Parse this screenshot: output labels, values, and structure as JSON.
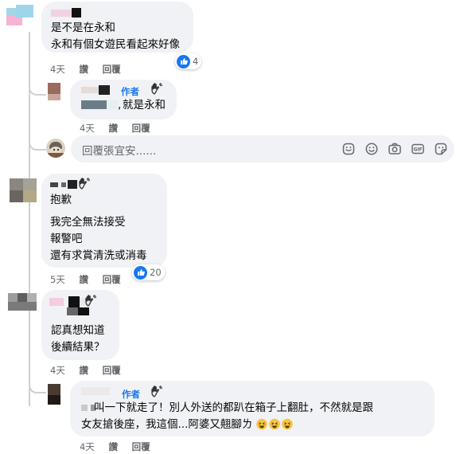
{
  "comments": [
    {
      "lines": [
        "是不是在永和",
        "永和有個女遊民看起來好像"
      ],
      "reaction_count": "4",
      "actions": [
        "4天",
        "讚",
        "回覆"
      ]
    },
    {
      "author_badge": "作者",
      "lines_prefix": ",",
      "text": "就是永和",
      "actions": [
        "4天",
        "讚",
        "回覆"
      ]
    },
    {
      "lines": [
        "抱歉",
        "我完全無法接受",
        "報警吧",
        "還有求賞清洗或消毒"
      ],
      "reaction_count": "20",
      "actions": [
        "5天",
        "讚",
        "回覆"
      ]
    },
    {
      "lines": [
        "認真想知道",
        "後續結果？"
      ],
      "actions": [
        "4天",
        "讚",
        "回覆"
      ]
    },
    {
      "author_badge": "作者",
      "lines": [
        "叫一下就走了！別人外送的都趴在箱子上翻肚，不然就是跟",
        "女友搶後座，我這個...阿婆又翹腳ㄌ"
      ],
      "actions": [
        "4天",
        "讚",
        "回覆"
      ]
    }
  ],
  "reply_input": {
    "placeholder": "回覆張宜安......"
  },
  "icons": [
    "like-icon",
    "wave-hand-icon",
    "sticker-icon",
    "emoji-icon",
    "camera-icon",
    "gif-icon",
    "sticker-smile-icon",
    "grin-emoji-icon"
  ],
  "colors": {
    "accent": "#1877f2",
    "bubble": "#f0f2f5",
    "muted": "#65676b"
  }
}
